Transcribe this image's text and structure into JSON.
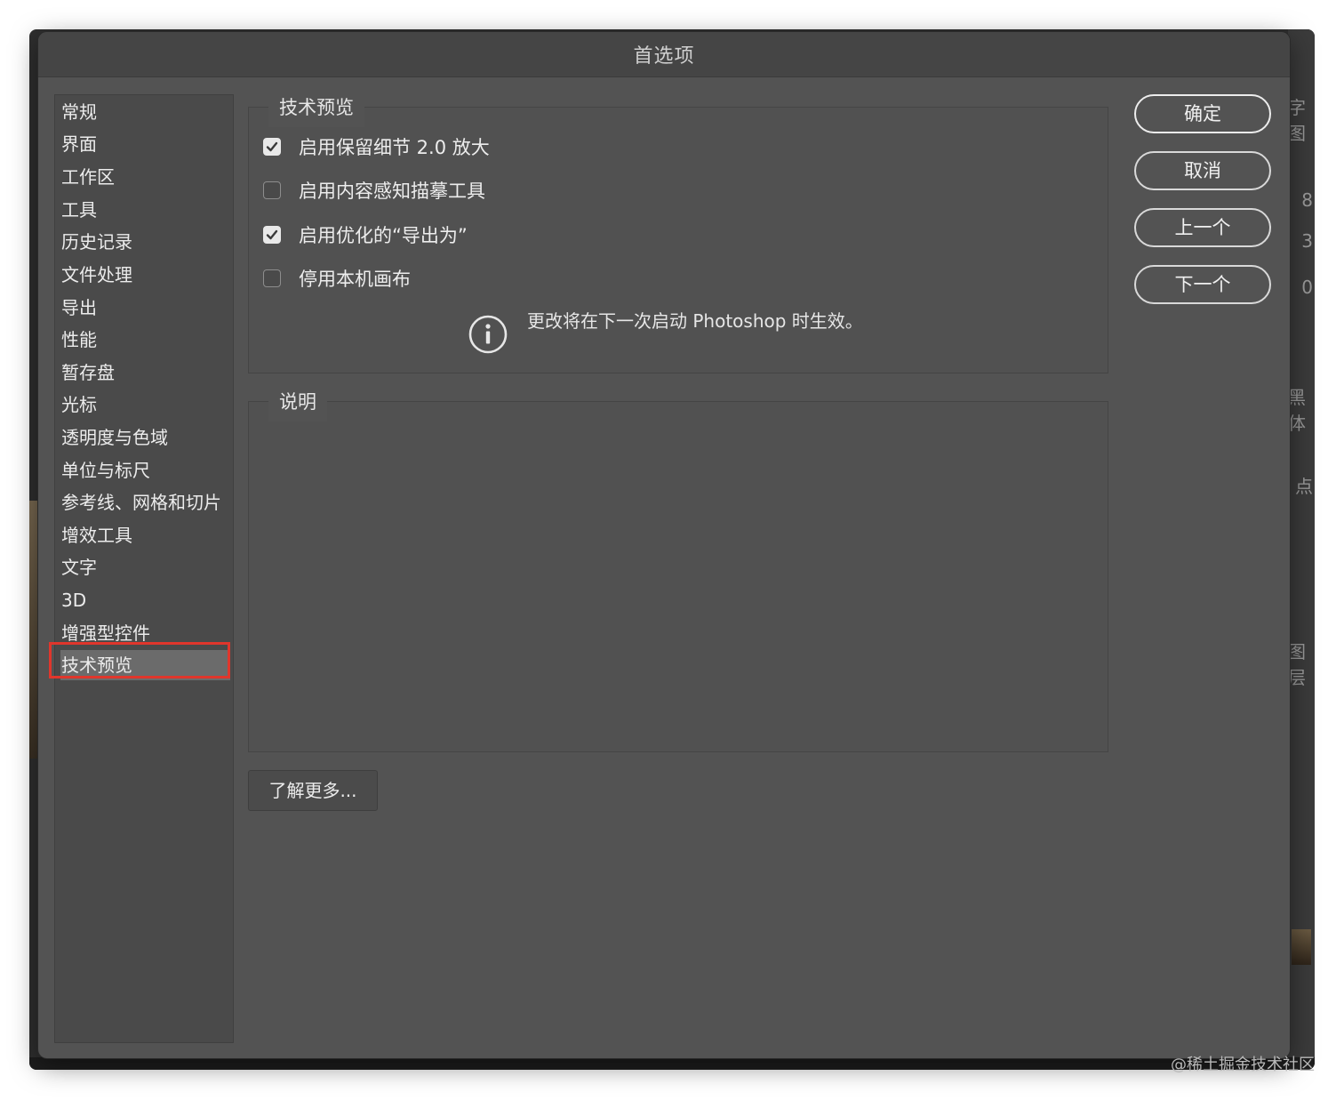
{
  "dialog": {
    "title": "首选项"
  },
  "sidebar": {
    "items": [
      {
        "label": "常规",
        "selected": false
      },
      {
        "label": "界面",
        "selected": false
      },
      {
        "label": "工作区",
        "selected": false
      },
      {
        "label": "工具",
        "selected": false
      },
      {
        "label": "历史记录",
        "selected": false
      },
      {
        "label": "文件处理",
        "selected": false
      },
      {
        "label": "导出",
        "selected": false
      },
      {
        "label": "性能",
        "selected": false
      },
      {
        "label": "暂存盘",
        "selected": false
      },
      {
        "label": "光标",
        "selected": false
      },
      {
        "label": "透明度与色域",
        "selected": false
      },
      {
        "label": "单位与标尺",
        "selected": false
      },
      {
        "label": "参考线、网格和切片",
        "selected": false
      },
      {
        "label": "增效工具",
        "selected": false
      },
      {
        "label": "文字",
        "selected": false
      },
      {
        "label": "3D",
        "selected": false
      },
      {
        "label": "增强型控件",
        "selected": false
      },
      {
        "label": "技术预览",
        "selected": true
      }
    ]
  },
  "tech_preview": {
    "legend": "技术预览",
    "options": [
      {
        "label": "启用保留细节 2.0 放大",
        "checked": true
      },
      {
        "label": "启用内容感知描摹工具",
        "checked": false
      },
      {
        "label": "启用优化的“导出为”",
        "checked": true
      },
      {
        "label": "停用本机画布",
        "checked": false
      }
    ],
    "info_text": "更改将在下一次启动 Photoshop 时生效。"
  },
  "description": {
    "legend": "说明"
  },
  "learn_more_label": "了解更多...",
  "buttons": {
    "ok": "确定",
    "cancel": "取消",
    "prev": "上一个",
    "next": "下一个"
  },
  "background_fragments": [
    "字图",
    "8",
    "3",
    "0",
    "黑体",
    "点",
    "图层"
  ],
  "watermark": "@稀土掘金技术社区",
  "colors": {
    "dialog_bg": "#535353",
    "highlight": "#e0362c",
    "checkbox_checked": "#e9e9e9"
  }
}
